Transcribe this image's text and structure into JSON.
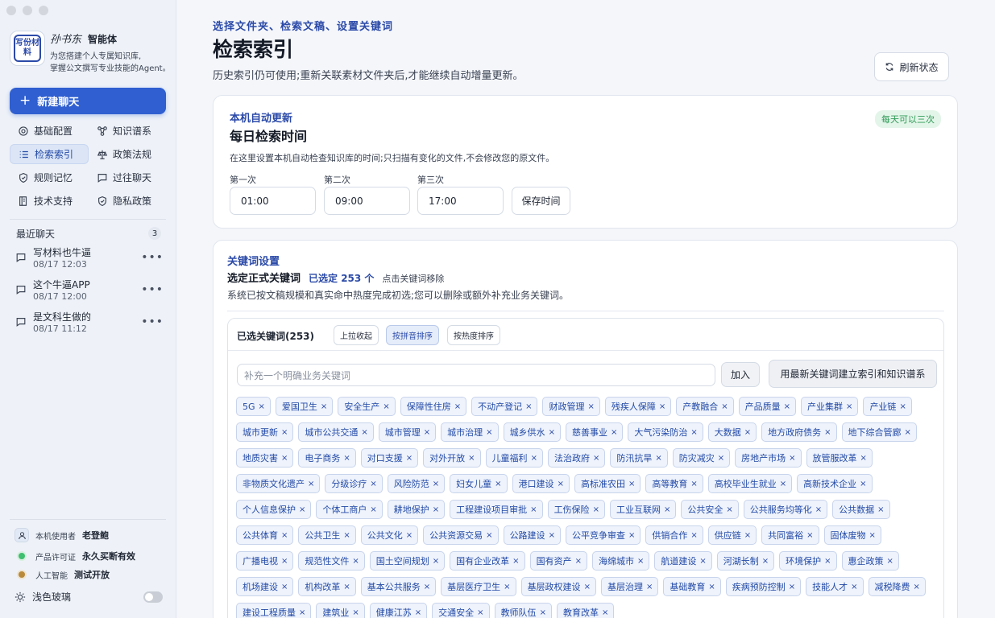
{
  "brand": {
    "logo_text": "写份材料",
    "script_name": "孙书东",
    "name": "智能体",
    "desc_line1": "为您搭建个人专属知识库,",
    "desc_line2": "掌握公文撰写专业技能的Agent。"
  },
  "sidebar": {
    "new_chat": "新建聊天",
    "nav": [
      {
        "label": "基础配置",
        "icon": "gear-icon"
      },
      {
        "label": "知识谱系",
        "icon": "graph-icon"
      },
      {
        "label": "检索索引",
        "icon": "list-icon",
        "active": true
      },
      {
        "label": "政策法规",
        "icon": "law-icon"
      },
      {
        "label": "规则记忆",
        "icon": "shield-icon"
      },
      {
        "label": "过往聊天",
        "icon": "chat-icon"
      },
      {
        "label": "技术支持",
        "icon": "book-icon"
      },
      {
        "label": "隐私政策",
        "icon": "shield-check-icon"
      }
    ],
    "recent_title": "最近聊天",
    "recent_count": "3",
    "chats": [
      {
        "title": "写材料也牛逼",
        "time": "08/17 12:03"
      },
      {
        "title": "这个牛逼APP",
        "time": "08/17 12:00"
      },
      {
        "title": "是文科生做的",
        "time": "08/17 11:12"
      }
    ],
    "user_label": "本机使用者",
    "user_name": "老登鲍",
    "license_label": "产品许可证",
    "license_value": "永久买断有效",
    "ai_label": "人工智能",
    "ai_value": "测试开放",
    "theme_label": "浅色玻璃"
  },
  "header": {
    "eyebrow": "选择文件夹、检索文稿、设置关键词",
    "title": "检索索引",
    "desc": "历史索引仍可使用;重新关联素材文件夹后,才能继续自动增量更新。",
    "refresh": "刷新状态"
  },
  "schedule": {
    "eyebrow": "本机自动更新",
    "title": "每日检索时间",
    "badge": "每天可以三次",
    "desc": "在这里设置本机自动检查知识库的时间;只扫描有变化的文件,不会修改您的原文件。",
    "first_label": "第一次",
    "second_label": "第二次",
    "third_label": "第三次",
    "first_value": "01:00",
    "second_value": "09:00",
    "third_value": "17:00",
    "save": "保存时间"
  },
  "keywords": {
    "eyebrow": "关键词设置",
    "title": "选定正式关键词",
    "selected_count": "已选定 253 个",
    "hint": "点击关键词移除",
    "desc": "系统已按文稿规模和真实命中热度完成初选;您可以删除或额外补充业务关键词。",
    "panel_title": "已选关键词(253)",
    "collapse": "上拉收起",
    "sort_pinyin": "按拼音排序",
    "sort_heat": "按热度排序",
    "input_placeholder": "补充一个明确业务关键词",
    "add": "加入",
    "build": "用最新关键词建立索引和知识谱系",
    "remove_glyph": "×",
    "tags": [
      "5G",
      "爱国卫生",
      "安全生产",
      "保障性住房",
      "不动产登记",
      "财政管理",
      "残疾人保障",
      "产教融合",
      "产品质量",
      "产业集群",
      "产业链",
      "城市更新",
      "城市公共交通",
      "城市管理",
      "城市治理",
      "城乡供水",
      "慈善事业",
      "大气污染防治",
      "大数据",
      "地方政府债务",
      "地下综合管廊",
      "地质灾害",
      "电子商务",
      "对口支援",
      "对外开放",
      "儿童福利",
      "法治政府",
      "防汛抗旱",
      "防灾减灾",
      "房地产市场",
      "放管服改革",
      "非物质文化遗产",
      "分级诊疗",
      "风险防范",
      "妇女儿童",
      "港口建设",
      "高标准农田",
      "高等教育",
      "高校毕业生就业",
      "高新技术企业",
      "个人信息保护",
      "个体工商户",
      "耕地保护",
      "工程建设项目审批",
      "工伤保险",
      "工业互联网",
      "公共安全",
      "公共服务均等化",
      "公共数据",
      "公共体育",
      "公共卫生",
      "公共文化",
      "公共资源交易",
      "公路建设",
      "公平竞争审查",
      "供销合作",
      "供应链",
      "共同富裕",
      "固体废物",
      "广播电视",
      "规范性文件",
      "国土空间规划",
      "国有企业改革",
      "国有资产",
      "海绵城市",
      "航道建设",
      "河湖长制",
      "环境保护",
      "惠企政策",
      "机场建设",
      "机构改革",
      "基本公共服务",
      "基层医疗卫生",
      "基层政权建设",
      "基层治理",
      "基础教育",
      "疾病预防控制",
      "技能人才",
      "减税降费",
      "建设工程质量",
      "建筑业",
      "健康江苏",
      "交通安全",
      "教师队伍",
      "教育改革"
    ]
  }
}
